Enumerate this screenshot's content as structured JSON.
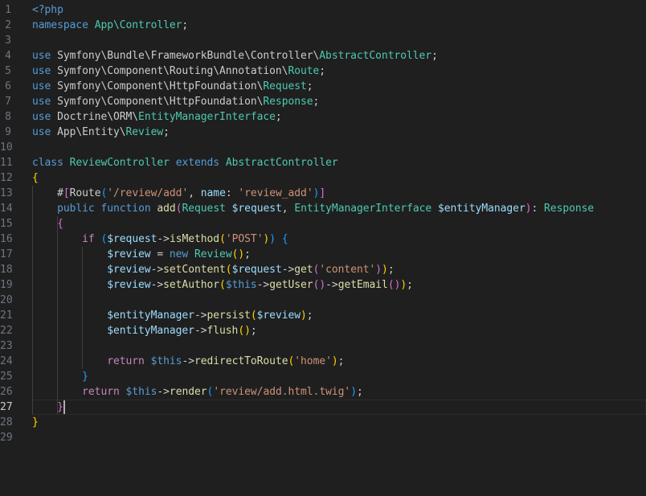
{
  "editor": {
    "language": "php",
    "active_line": 27,
    "colors": {
      "background": "#1f1f1f",
      "keyword": "#569cd6",
      "control": "#c586c0",
      "type": "#4ec9b0",
      "variable": "#9cdcfe",
      "function": "#dcdcaa",
      "string": "#ce9178",
      "bracket_level_1": "#ffd700",
      "bracket_level_2": "#da70d6",
      "bracket_level_3": "#179fff"
    },
    "lines": [
      {
        "n": "1",
        "tokens": [
          [
            "kw",
            "<?php"
          ]
        ]
      },
      {
        "n": "2",
        "tokens": [
          [
            "kw",
            "namespace"
          ],
          [
            "plain",
            " "
          ],
          [
            "type",
            "App\\Controller"
          ],
          [
            "plain",
            ";"
          ]
        ]
      },
      {
        "n": "3",
        "tokens": []
      },
      {
        "n": "4",
        "tokens": [
          [
            "kw",
            "use"
          ],
          [
            "plain",
            " Symfony\\Bundle\\FrameworkBundle\\Controller\\"
          ],
          [
            "type",
            "AbstractController"
          ],
          [
            "plain",
            ";"
          ]
        ]
      },
      {
        "n": "5",
        "tokens": [
          [
            "kw",
            "use"
          ],
          [
            "plain",
            " Symfony\\Component\\Routing\\Annotation\\"
          ],
          [
            "type",
            "Route"
          ],
          [
            "plain",
            ";"
          ]
        ]
      },
      {
        "n": "6",
        "tokens": [
          [
            "kw",
            "use"
          ],
          [
            "plain",
            " Symfony\\Component\\HttpFoundation\\"
          ],
          [
            "type",
            "Request"
          ],
          [
            "plain",
            ";"
          ]
        ]
      },
      {
        "n": "7",
        "tokens": [
          [
            "kw",
            "use"
          ],
          [
            "plain",
            " Symfony\\Component\\HttpFoundation\\"
          ],
          [
            "type",
            "Response"
          ],
          [
            "plain",
            ";"
          ]
        ]
      },
      {
        "n": "8",
        "tokens": [
          [
            "kw",
            "use"
          ],
          [
            "plain",
            " Doctrine\\ORM\\"
          ],
          [
            "type",
            "EntityManagerInterface"
          ],
          [
            "plain",
            ";"
          ]
        ]
      },
      {
        "n": "9",
        "tokens": [
          [
            "kw",
            "use"
          ],
          [
            "plain",
            " App\\Entity\\"
          ],
          [
            "type",
            "Review"
          ],
          [
            "plain",
            ";"
          ]
        ]
      },
      {
        "n": "10",
        "tokens": []
      },
      {
        "n": "11",
        "tokens": [
          [
            "kw",
            "class"
          ],
          [
            "plain",
            " "
          ],
          [
            "type",
            "ReviewController"
          ],
          [
            "plain",
            " "
          ],
          [
            "kw",
            "extends"
          ],
          [
            "plain",
            " "
          ],
          [
            "type",
            "AbstractController"
          ]
        ]
      },
      {
        "n": "12",
        "tokens": [
          [
            "b1",
            "{"
          ]
        ]
      },
      {
        "n": "13",
        "tokens": [
          [
            "plain",
            "    #"
          ],
          [
            "b2",
            "["
          ],
          [
            "plain",
            "Route"
          ],
          [
            "b3",
            "("
          ],
          [
            "str",
            "'/review/add'"
          ],
          [
            "plain",
            ", "
          ],
          [
            "attr",
            "name"
          ],
          [
            "plain",
            ": "
          ],
          [
            "str",
            "'review_add'"
          ],
          [
            "b3",
            ")"
          ],
          [
            "b2",
            "]"
          ]
        ]
      },
      {
        "n": "14",
        "tokens": [
          [
            "plain",
            "    "
          ],
          [
            "kw",
            "public"
          ],
          [
            "plain",
            " "
          ],
          [
            "kw",
            "function"
          ],
          [
            "plain",
            " "
          ],
          [
            "fn",
            "add"
          ],
          [
            "b2",
            "("
          ],
          [
            "type",
            "Request"
          ],
          [
            "plain",
            " "
          ],
          [
            "var",
            "$request"
          ],
          [
            "plain",
            ", "
          ],
          [
            "type",
            "EntityManagerInterface"
          ],
          [
            "plain",
            " "
          ],
          [
            "var",
            "$entityManager"
          ],
          [
            "b2",
            ")"
          ],
          [
            "plain",
            ": "
          ],
          [
            "type",
            "Response"
          ]
        ]
      },
      {
        "n": "15",
        "tokens": [
          [
            "plain",
            "    "
          ],
          [
            "b2",
            "{"
          ]
        ]
      },
      {
        "n": "16",
        "tokens": [
          [
            "plain",
            "        "
          ],
          [
            "ctl",
            "if"
          ],
          [
            "plain",
            " "
          ],
          [
            "b3",
            "("
          ],
          [
            "var",
            "$request"
          ],
          [
            "plain",
            "->"
          ],
          [
            "fn",
            "isMethod"
          ],
          [
            "b1",
            "("
          ],
          [
            "str",
            "'POST'"
          ],
          [
            "b1",
            ")"
          ],
          [
            "b3",
            ")"
          ],
          [
            "plain",
            " "
          ],
          [
            "b3",
            "{"
          ]
        ]
      },
      {
        "n": "17",
        "tokens": [
          [
            "plain",
            "            "
          ],
          [
            "var",
            "$review"
          ],
          [
            "plain",
            " = "
          ],
          [
            "kw",
            "new"
          ],
          [
            "plain",
            " "
          ],
          [
            "type",
            "Review"
          ],
          [
            "b1",
            "("
          ],
          [
            "b1",
            ")"
          ],
          [
            "plain",
            ";"
          ]
        ]
      },
      {
        "n": "18",
        "tokens": [
          [
            "plain",
            "            "
          ],
          [
            "var",
            "$review"
          ],
          [
            "plain",
            "->"
          ],
          [
            "fn",
            "setContent"
          ],
          [
            "b1",
            "("
          ],
          [
            "var",
            "$request"
          ],
          [
            "plain",
            "->"
          ],
          [
            "fn",
            "get"
          ],
          [
            "b2",
            "("
          ],
          [
            "str",
            "'content'"
          ],
          [
            "b2",
            ")"
          ],
          [
            "b1",
            ")"
          ],
          [
            "plain",
            ";"
          ]
        ]
      },
      {
        "n": "19",
        "tokens": [
          [
            "plain",
            "            "
          ],
          [
            "var",
            "$review"
          ],
          [
            "plain",
            "->"
          ],
          [
            "fn",
            "setAuthor"
          ],
          [
            "b1",
            "("
          ],
          [
            "this",
            "$this"
          ],
          [
            "plain",
            "->"
          ],
          [
            "fn",
            "getUser"
          ],
          [
            "b2",
            "("
          ],
          [
            "b2",
            ")"
          ],
          [
            "plain",
            "->"
          ],
          [
            "fn",
            "getEmail"
          ],
          [
            "b2",
            "("
          ],
          [
            "b2",
            ")"
          ],
          [
            "b1",
            ")"
          ],
          [
            "plain",
            ";"
          ]
        ]
      },
      {
        "n": "20",
        "tokens": []
      },
      {
        "n": "21",
        "tokens": [
          [
            "plain",
            "            "
          ],
          [
            "var",
            "$entityManager"
          ],
          [
            "plain",
            "->"
          ],
          [
            "fn",
            "persist"
          ],
          [
            "b1",
            "("
          ],
          [
            "var",
            "$review"
          ],
          [
            "b1",
            ")"
          ],
          [
            "plain",
            ";"
          ]
        ]
      },
      {
        "n": "22",
        "tokens": [
          [
            "plain",
            "            "
          ],
          [
            "var",
            "$entityManager"
          ],
          [
            "plain",
            "->"
          ],
          [
            "fn",
            "flush"
          ],
          [
            "b1",
            "("
          ],
          [
            "b1",
            ")"
          ],
          [
            "plain",
            ";"
          ]
        ]
      },
      {
        "n": "23",
        "tokens": []
      },
      {
        "n": "24",
        "tokens": [
          [
            "plain",
            "            "
          ],
          [
            "ctl",
            "return"
          ],
          [
            "plain",
            " "
          ],
          [
            "this",
            "$this"
          ],
          [
            "plain",
            "->"
          ],
          [
            "fn",
            "redirectToRoute"
          ],
          [
            "b1",
            "("
          ],
          [
            "str",
            "'home'"
          ],
          [
            "b1",
            ")"
          ],
          [
            "plain",
            ";"
          ]
        ]
      },
      {
        "n": "25",
        "tokens": [
          [
            "plain",
            "        "
          ],
          [
            "b3",
            "}"
          ]
        ]
      },
      {
        "n": "26",
        "tokens": [
          [
            "plain",
            "        "
          ],
          [
            "ctl",
            "return"
          ],
          [
            "plain",
            " "
          ],
          [
            "this",
            "$this"
          ],
          [
            "plain",
            "->"
          ],
          [
            "fn",
            "render"
          ],
          [
            "b3",
            "("
          ],
          [
            "str",
            "'review/add.html.twig'"
          ],
          [
            "b3",
            ")"
          ],
          [
            "plain",
            ";"
          ]
        ]
      },
      {
        "n": "27",
        "tokens": [
          [
            "plain",
            "    "
          ],
          [
            "b2",
            "}"
          ]
        ]
      },
      {
        "n": "28",
        "tokens": [
          [
            "b1",
            "}"
          ]
        ]
      },
      {
        "n": "29",
        "tokens": []
      }
    ]
  }
}
